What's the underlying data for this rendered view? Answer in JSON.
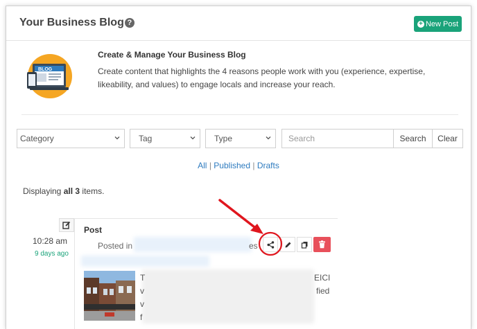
{
  "header": {
    "title": "Your Business Blog",
    "help_icon": "question-circle-icon",
    "new_post_label": "New Post"
  },
  "intro": {
    "illustration_label": "BLOG",
    "heading": "Create & Manage Your Business Blog",
    "text": "Create content that highlights the 4 reasons people work with you (experience, expertise, likeability, and values) to engage locals and increase your reach."
  },
  "filters": {
    "category": "Category",
    "tag": "Tag",
    "type": "Type",
    "search_placeholder": "Search",
    "search_button": "Search",
    "clear_button": "Clear"
  },
  "status_links": {
    "all": "All",
    "sep1": "|",
    "published": "Published",
    "sep2": "|",
    "drafts": "Drafts"
  },
  "list_summary": {
    "prefix": "Displaying",
    "count_text": "all 3",
    "suffix": "items."
  },
  "post": {
    "time": "10:28 am",
    "ago": "9 days ago",
    "type": "Post",
    "posted_in_label": "Posted in",
    "posted_in_tail": "es",
    "snippet_fragments": [
      "T",
      "EICI",
      "v",
      "fied",
      "v",
      "f"
    ],
    "actions": [
      "share-icon",
      "pencil-icon",
      "copy-icon",
      "trash-icon"
    ]
  },
  "colors": {
    "accent_green": "#1aa37a",
    "link_blue": "#2e7bbf",
    "delete_red": "#e8505b",
    "annotation_red": "#e0161e"
  }
}
